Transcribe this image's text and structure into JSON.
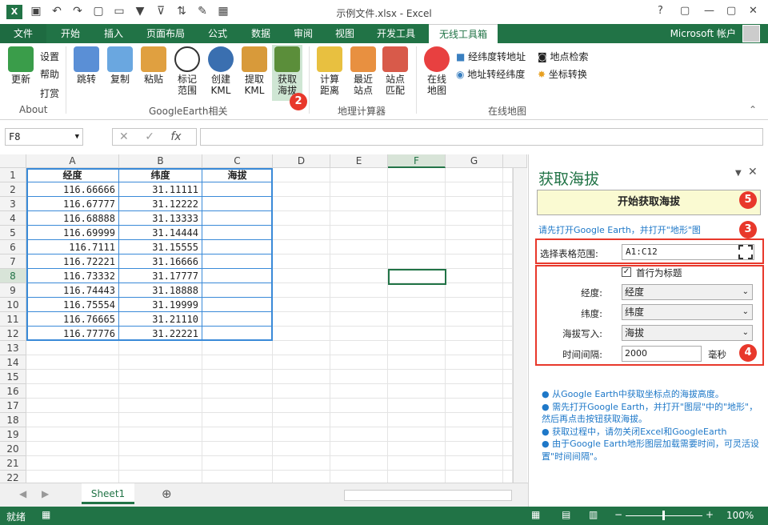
{
  "window": {
    "title": "示例文件.xlsx - Excel",
    "app_icon": "X",
    "help": "?",
    "restore": "▢",
    "minimize": "—",
    "close": "✕"
  },
  "qat": {
    "save": "save-icon",
    "undo": "undo-icon",
    "redo": "redo-icon"
  },
  "tabs": [
    "文件",
    "开始",
    "插入",
    "页面布局",
    "公式",
    "数据",
    "审阅",
    "视图",
    "开发工具",
    "无线工具箱"
  ],
  "account": "Microsoft 帐户",
  "ribbon": {
    "about": {
      "update": "更新",
      "settings": "设置",
      "help": "帮助",
      "donate": "打赏",
      "group": "About"
    },
    "google": {
      "jump": "跳转",
      "copy": "复制",
      "paste": "粘贴",
      "mark_l1": "标记",
      "mark_l2": "范围",
      "create_l1": "创建",
      "create_l2": "KML",
      "extract_l1": "提取",
      "extract_l2": "KML",
      "alt_l1": "获取",
      "alt_l2": "海拔",
      "group": "GoogleEarth相关"
    },
    "calc": {
      "dist_l1": "计算",
      "dist_l2": "距离",
      "near_l1": "最近",
      "near_l2": "站点",
      "match_l1": "站点",
      "match_l2": "匹配",
      "group": "地理计算器"
    },
    "online": {
      "map_l1": "在线",
      "map_l2": "地图",
      "geo2addr": "经纬度转地址",
      "addr2geo": "地址转经纬度",
      "search": "地点检索",
      "convert": "坐标转换",
      "group": "在线地图"
    }
  },
  "formula": {
    "namebox": "F8",
    "fx": "fx",
    "value": ""
  },
  "columns": [
    "A",
    "B",
    "C",
    "D",
    "E",
    "F",
    "G"
  ],
  "rows": [
    "1",
    "2",
    "3",
    "4",
    "5",
    "6",
    "7",
    "8",
    "9",
    "10",
    "11",
    "12",
    "13",
    "14",
    "15",
    "16",
    "17",
    "18",
    "19",
    "20",
    "21",
    "22"
  ],
  "table": {
    "headers": [
      "经度",
      "纬度",
      "海拔"
    ],
    "data": [
      [
        "116.66666",
        "31.11111",
        ""
      ],
      [
        "116.67777",
        "31.12222",
        ""
      ],
      [
        "116.68888",
        "31.13333",
        ""
      ],
      [
        "116.69999",
        "31.14444",
        ""
      ],
      [
        "116.7111",
        "31.15555",
        ""
      ],
      [
        "116.72221",
        "31.16666",
        ""
      ],
      [
        "116.73332",
        "31.17777",
        ""
      ],
      [
        "116.74443",
        "31.18888",
        ""
      ],
      [
        "116.75554",
        "31.19999",
        ""
      ],
      [
        "116.76665",
        "31.21110",
        ""
      ],
      [
        "116.77776",
        "31.22221",
        ""
      ]
    ]
  },
  "sheet_tab": "Sheet1",
  "status": {
    "ready": "就绪",
    "zoom": "100%"
  },
  "pane": {
    "title": "获取海拔",
    "start": "开始获取海拔",
    "hint": "请先打开Google Earth，并打开\"地形\"图",
    "range_label": "选择表格范围:",
    "range_value": "A1:C12",
    "first_row": "首行为标题",
    "lng_label": "经度:",
    "lng_value": "经度",
    "lat_label": "纬度:",
    "lat_value": "纬度",
    "alt_label": "海拔写入:",
    "alt_value": "海拔",
    "interval_label": "时间间隔:",
    "interval_value": "2000",
    "unit": "毫秒",
    "notes": [
      "● 从Google Earth中获取坐标点的海拔高度。",
      "● 需先打开Google Earth，并打开\"图层\"中的\"地形\"，然后再点击按钮获取海拔。",
      "● 获取过程中，请勿关闭Excel和GoogleEarth",
      "● 由于Google Earth地形图层加载需要时间，可灵活设置\"时间间隔\"。"
    ]
  },
  "badges": [
    "2",
    "3",
    "4",
    "5"
  ]
}
